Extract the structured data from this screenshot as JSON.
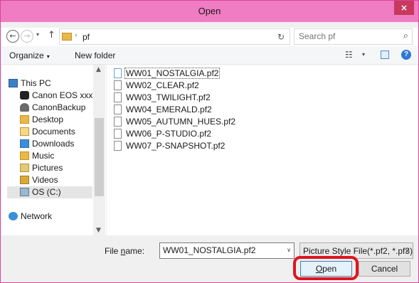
{
  "window": {
    "title": "Open",
    "close_label": "×"
  },
  "address": {
    "back_glyph": "←",
    "forward_glyph": "→",
    "recent_glyph": "▾",
    "up_glyph": "↑",
    "crumb_sep": "›",
    "crumb": "pf",
    "dropdown_glyph": "∨",
    "refresh_glyph": "↻"
  },
  "search": {
    "placeholder": "Search pf",
    "icon": "⌕"
  },
  "toolbar": {
    "organize_label": "Organize",
    "organize_caret": "▾",
    "newfolder_label": "New folder",
    "view_glyph": "☷",
    "view_caret": "▾",
    "help_glyph": "?"
  },
  "nav": {
    "scroll_up": "▲",
    "scroll_down": "▼",
    "items": [
      {
        "label": "This PC",
        "icon": "pc-icon"
      },
      {
        "label": "Canon EOS xxx",
        "icon": "camera-icon"
      },
      {
        "label": "CanonBackup",
        "icon": "user-folder-icon"
      },
      {
        "label": "Desktop",
        "icon": "desktop-folder-icon"
      },
      {
        "label": "Documents",
        "icon": "documents-folder-icon"
      },
      {
        "label": "Downloads",
        "icon": "downloads-folder-icon"
      },
      {
        "label": "Music",
        "icon": "music-folder-icon"
      },
      {
        "label": "Pictures",
        "icon": "pictures-folder-icon"
      },
      {
        "label": "Videos",
        "icon": "videos-folder-icon"
      },
      {
        "label": "OS (C:)",
        "icon": "drive-icon"
      },
      {
        "label": "Network",
        "icon": "network-icon"
      }
    ]
  },
  "files": [
    "WW01_NOSTALGIA.pf2",
    "WW02_CLEAR.pf2",
    "WW03_TWILIGHT.pf2",
    "WW04_EMERALD.pf2",
    "WW05_AUTUMN_HUES.pf2",
    "WW06_P-STUDIO.pf2",
    "WW07_P-SNAPSHOT.pf2"
  ],
  "footer": {
    "filename_label_pre": "File ",
    "filename_label_u": "n",
    "filename_label_post": "ame:",
    "filename_value": "WW01_NOSTALGIA.pf2",
    "filename_drop": "∨",
    "filetype_value": "Picture Style File(*.pf2, *.pf3)",
    "filetype_drop": "∨",
    "open_u": "O",
    "open_rest": "pen",
    "cancel_label": "Cancel"
  },
  "colors": {
    "titlebar": "#f07cc3",
    "close_button": "#c7395d",
    "highlight": "#e0141e"
  }
}
